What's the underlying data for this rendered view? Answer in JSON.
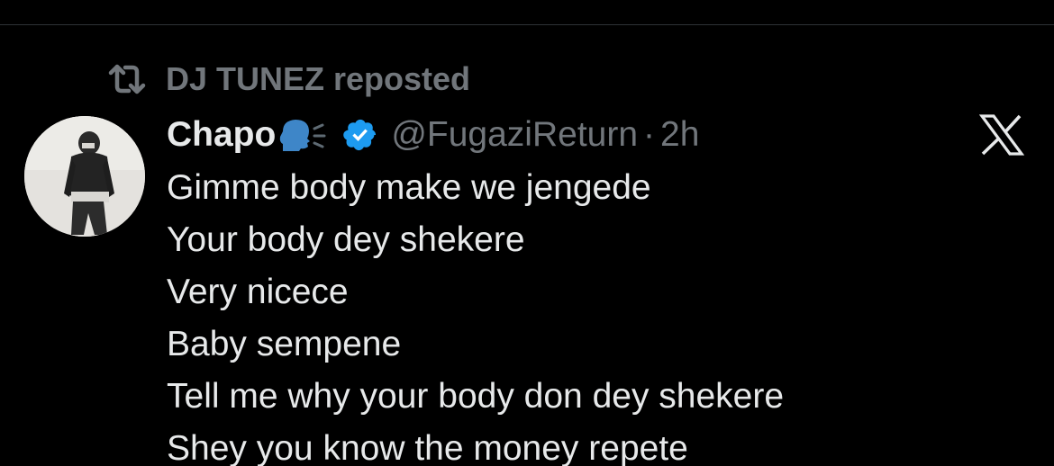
{
  "repost": {
    "icon": "repost-icon",
    "text": "DJ TUNEZ reposted"
  },
  "tweet": {
    "author": {
      "display_name": "Chapo",
      "name_emoji": "speaking-head-icon",
      "verified_icon": "verified-badge-icon",
      "handle": "@FugaziReturn",
      "separator": "·",
      "time": "2h",
      "avatar": "avatar"
    },
    "lines": [
      "Gimme body make we jengede",
      "Your body dey shekere",
      "Very nicece",
      "Baby sempene",
      "Tell me why your body don dey shekere",
      "Shey you know the money repete"
    ]
  },
  "brand": {
    "logo": "x-logo-icon"
  },
  "colors": {
    "background": "#000000",
    "text_primary": "#e7e9ea",
    "text_secondary": "#71767b",
    "verified_blue": "#1d9bf0",
    "divider": "#2f3336"
  }
}
